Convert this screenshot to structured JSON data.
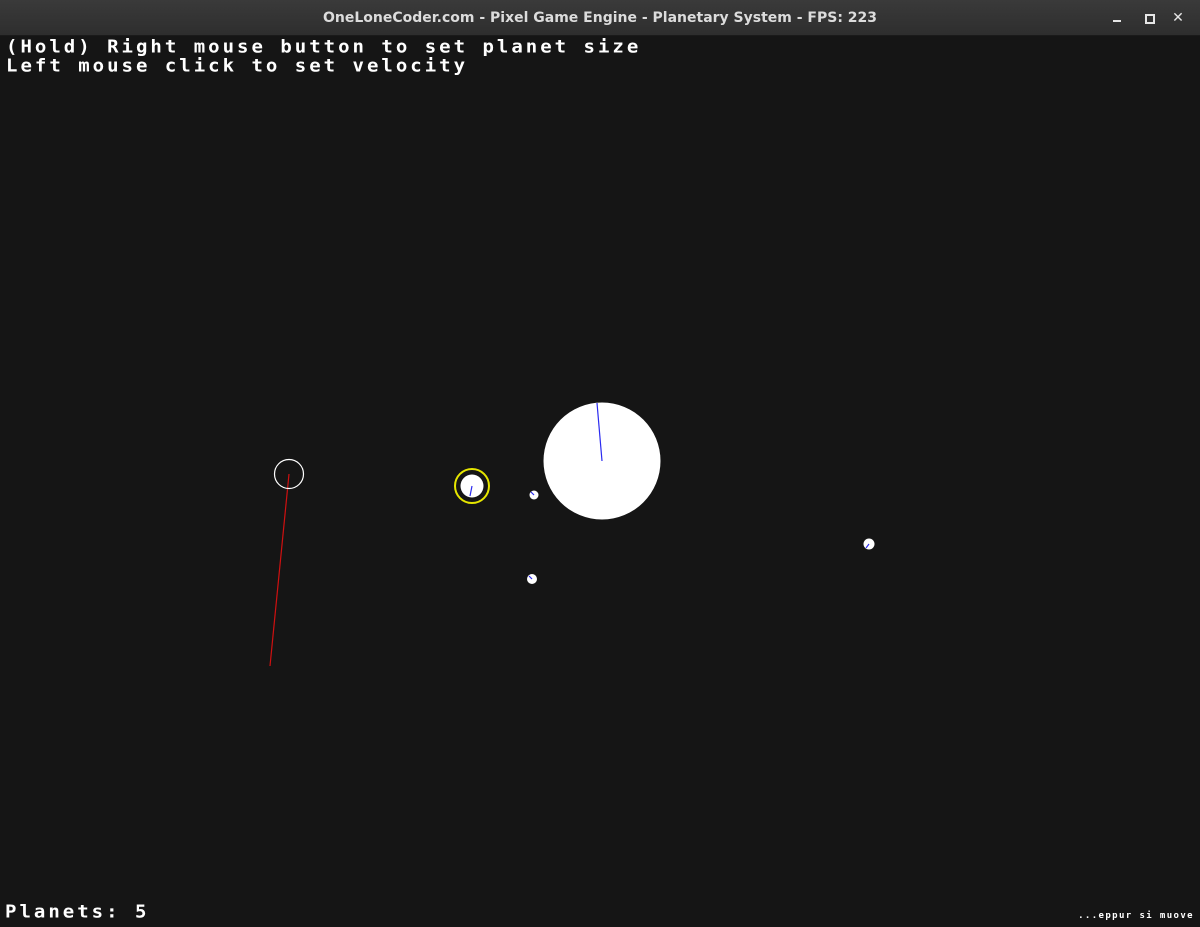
{
  "window": {
    "title": "OneLoneCoder.com - Pixel Game Engine - Planetary System - FPS: 223",
    "minimize_icon": "minimize-icon",
    "maximize_icon": "maximize-icon",
    "close_icon": "close-icon",
    "close_glyph": "✕"
  },
  "hud": {
    "instruction_line_1": "(Hold) Right mouse button to set planet size",
    "instruction_line_2": "Left mouse click to set velocity",
    "planet_count": "Planets: 5",
    "motto": "...eppur si muove"
  },
  "colors": {
    "background": "#151515",
    "planet_fill": "#ffffff",
    "velocity_line": "#2a2af0",
    "selection_ring": "#e6e600",
    "placement_ring": "#ffffff",
    "placement_velocity_line": "#d01010"
  }
}
